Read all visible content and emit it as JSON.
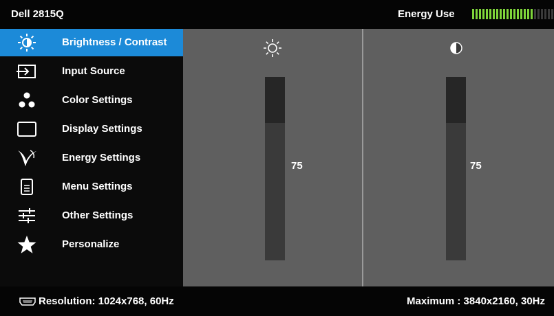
{
  "header": {
    "model": "Dell 2815Q",
    "energy_label": "Energy Use",
    "energy_level": 0.77
  },
  "menu": [
    {
      "label": "Brightness / Contrast",
      "icon": "sun-icon",
      "active": true
    },
    {
      "label": "Input Source",
      "icon": "input-source-icon"
    },
    {
      "label": "Color Settings",
      "icon": "color-dots-icon"
    },
    {
      "label": "Display Settings",
      "icon": "display-icon"
    },
    {
      "label": "Energy Settings",
      "icon": "leaf-icon"
    },
    {
      "label": "Menu Settings",
      "icon": "menu-doc-icon"
    },
    {
      "label": "Other Settings",
      "icon": "sliders-icon"
    },
    {
      "label": "Personalize",
      "icon": "star-icon"
    }
  ],
  "brightness": {
    "value": "75",
    "icon": "sun-icon",
    "level": 0.75
  },
  "contrast": {
    "value": "75",
    "icon": "contrast-icon",
    "level": 0.75
  },
  "footer": {
    "resolution": "Resolution: 1024x768,  60Hz",
    "maximum": "Maximum : 3840x2160,  30Hz",
    "icon": "hdmi-icon"
  },
  "colors": {
    "accent": "#1c8ad8",
    "energy_on": "#7fd63a",
    "panel": "#5f5f5f"
  }
}
